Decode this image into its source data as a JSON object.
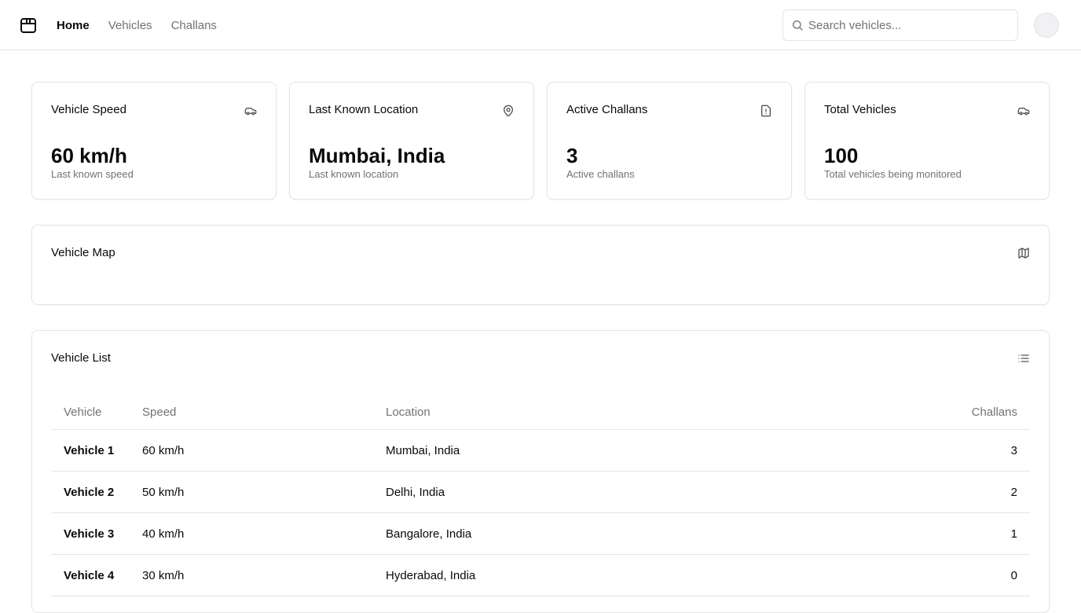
{
  "header": {
    "logo_icon": "package-icon",
    "nav": [
      {
        "label": "Home",
        "active": true
      },
      {
        "label": "Vehicles",
        "active": false
      },
      {
        "label": "Challans",
        "active": false
      }
    ],
    "search": {
      "placeholder": "Search vehicles...",
      "value": ""
    },
    "avatar_icon": "user-avatar"
  },
  "stats": [
    {
      "title": "Vehicle Speed",
      "icon": "car-icon",
      "value": "60 km/h",
      "subtitle": "Last known speed"
    },
    {
      "title": "Last Known Location",
      "icon": "map-pin-icon",
      "value": "Mumbai, India",
      "subtitle": "Last known location"
    },
    {
      "title": "Active Challans",
      "icon": "file-alert-icon",
      "value": "3",
      "subtitle": "Active challans"
    },
    {
      "title": "Total Vehicles",
      "icon": "car-icon",
      "value": "100",
      "subtitle": "Total vehicles being monitored"
    }
  ],
  "map_card": {
    "title": "Vehicle Map",
    "icon": "map-icon"
  },
  "list_card": {
    "title": "Vehicle List",
    "icon": "list-icon",
    "columns": [
      "Vehicle",
      "Speed",
      "Location",
      "Challans"
    ],
    "rows": [
      {
        "vehicle": "Vehicle 1",
        "speed": "60 km/h",
        "location": "Mumbai, India",
        "challans": "3"
      },
      {
        "vehicle": "Vehicle 2",
        "speed": "50 km/h",
        "location": "Delhi, India",
        "challans": "2"
      },
      {
        "vehicle": "Vehicle 3",
        "speed": "40 km/h",
        "location": "Bangalore, India",
        "challans": "1"
      },
      {
        "vehicle": "Vehicle 4",
        "speed": "30 km/h",
        "location": "Hyderabad, India",
        "challans": "0"
      }
    ]
  },
  "colors": {
    "text": "#09090b",
    "muted": "#71717a",
    "border": "#e4e4e7",
    "background": "#ffffff"
  }
}
